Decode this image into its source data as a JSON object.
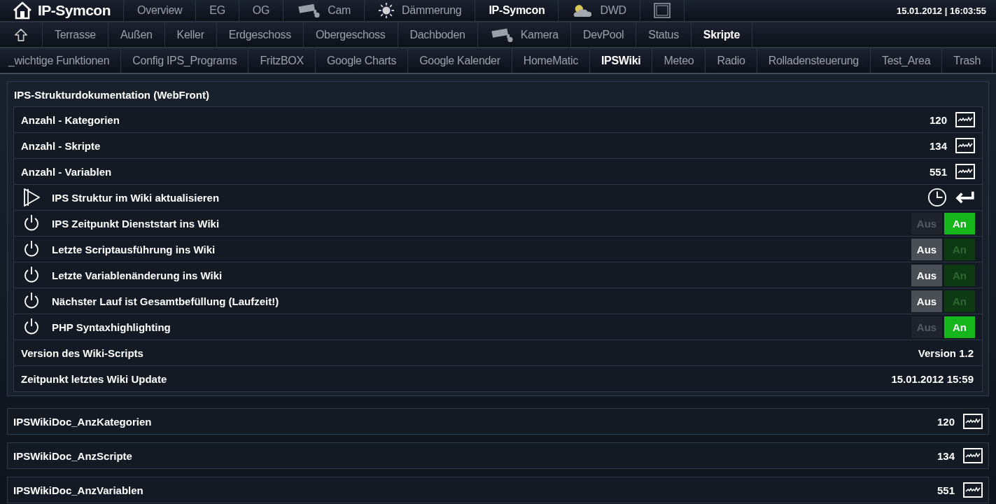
{
  "header": {
    "logo": "IP-Symcon",
    "datetime": "15.01.2012 | 16:03:55"
  },
  "top_tabs": [
    {
      "label": "Overview",
      "kind": "plain",
      "selected": false
    },
    {
      "label": "EG",
      "kind": "plain",
      "selected": false
    },
    {
      "label": "OG",
      "kind": "plain",
      "selected": false
    },
    {
      "label": "Cam",
      "kind": "camera",
      "selected": false
    },
    {
      "label": "Dämmerung",
      "kind": "sun",
      "selected": false
    },
    {
      "label": "IP-Symcon",
      "kind": "plain",
      "selected": true
    },
    {
      "label": "DWD",
      "kind": "weather",
      "selected": false
    },
    {
      "kind": "frame",
      "selected": false
    }
  ],
  "category_tabs": [
    {
      "label": "Terrasse",
      "kind": "plain",
      "selected": false
    },
    {
      "label": "Außen",
      "kind": "plain",
      "selected": false
    },
    {
      "label": "Keller",
      "kind": "plain",
      "selected": false
    },
    {
      "label": "Erdgeschoss",
      "kind": "plain",
      "selected": false
    },
    {
      "label": "Obergeschoss",
      "kind": "plain",
      "selected": false
    },
    {
      "label": "Dachboden",
      "kind": "plain",
      "selected": false
    },
    {
      "label": "Kamera",
      "kind": "camera",
      "selected": false
    },
    {
      "label": "DevPool",
      "kind": "plain",
      "selected": false
    },
    {
      "label": "Status",
      "kind": "plain",
      "selected": false
    },
    {
      "label": "Skripte",
      "kind": "plain",
      "selected": true
    }
  ],
  "script_tabs": [
    {
      "label": "_wichtige Funktionen",
      "selected": false
    },
    {
      "label": "Config IPS_Programs",
      "selected": false
    },
    {
      "label": "FritzBOX",
      "selected": false
    },
    {
      "label": "Google Charts",
      "selected": false
    },
    {
      "label": "Google Kalender",
      "selected": false
    },
    {
      "label": "HomeMatic",
      "selected": false
    },
    {
      "label": "IPSWiki",
      "selected": true
    },
    {
      "label": "Meteo",
      "selected": false
    },
    {
      "label": "Radio",
      "selected": false
    },
    {
      "label": "Rolladensteuerung",
      "selected": false
    },
    {
      "label": "Test_Area",
      "selected": false
    },
    {
      "label": "Trash",
      "selected": false
    }
  ],
  "panel": {
    "title": "IPS-Strukturdokumentation (WebFront)",
    "rows": [
      {
        "kind": "value",
        "label": "Anzahl - Kategorien",
        "value": "120"
      },
      {
        "kind": "value",
        "label": "Anzahl - Skripte",
        "value": "134"
      },
      {
        "kind": "value",
        "label": "Anzahl - Variablen",
        "value": "551"
      },
      {
        "kind": "action",
        "label": "IPS Struktur im Wiki aktualisieren"
      },
      {
        "kind": "switch",
        "label": "IPS Zeitpunkt Dienststart ins Wiki",
        "on": true,
        "off_label": "Aus",
        "on_label": "An"
      },
      {
        "kind": "switch",
        "label": "Letzte Scriptausführung ins Wiki",
        "on": false,
        "off_label": "Aus",
        "on_label": "An"
      },
      {
        "kind": "switch",
        "label": "Letzte Variablenänderung ins Wiki",
        "on": false,
        "off_label": "Aus",
        "on_label": "An"
      },
      {
        "kind": "switch",
        "label": "Nächster Lauf ist Gesamtbefüllung (Laufzeit!)",
        "on": false,
        "off_label": "Aus",
        "on_label": "An"
      },
      {
        "kind": "switch",
        "label": "PHP Syntaxhighlighting",
        "on": true,
        "off_label": "Aus",
        "on_label": "An"
      },
      {
        "kind": "text",
        "label": "Version des Wiki-Scripts",
        "value": "Version 1.2"
      },
      {
        "kind": "text",
        "label": "Zeitpunkt letztes Wiki Update",
        "value": "15.01.2012 15:59"
      }
    ]
  },
  "variables": [
    {
      "label": "IPSWikiDoc_AnzKategorien",
      "value": "120"
    },
    {
      "label": "IPSWikiDoc_AnzScripte",
      "value": "134"
    },
    {
      "label": "IPSWikiDoc_AnzVariablen",
      "value": "551"
    }
  ]
}
